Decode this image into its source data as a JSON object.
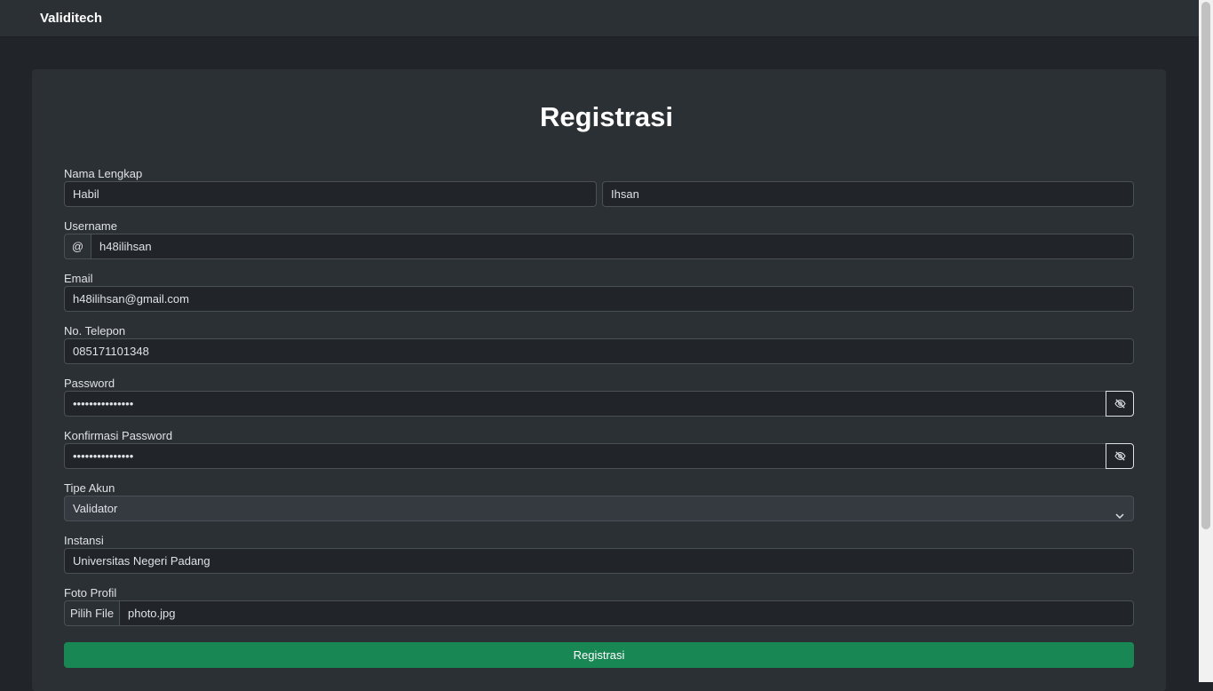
{
  "navbar": {
    "brand": "Validitech"
  },
  "form": {
    "title": "Registrasi",
    "full_name": {
      "label": "Nama Lengkap",
      "first": "Habil",
      "last": "Ihsan"
    },
    "username": {
      "label": "Username",
      "prefix": "@",
      "value": "h48ilihsan"
    },
    "email": {
      "label": "Email",
      "value": "h48ilihsan@gmail.com"
    },
    "phone": {
      "label": "No. Telepon",
      "value": "085171101348"
    },
    "password": {
      "label": "Password",
      "masked": "•••••••••••••••"
    },
    "confirm_password": {
      "label": "Konfirmasi Password",
      "masked": "•••••••••••••••"
    },
    "account_type": {
      "label": "Tipe Akun",
      "selected": "Validator"
    },
    "institution": {
      "label": "Instansi",
      "value": "Universitas Negeri Padang"
    },
    "photo": {
      "label": "Foto Profil",
      "button": "Pilih File",
      "filename": "photo.jpg"
    },
    "submit_label": "Registrasi"
  },
  "icons": {
    "password_toggle": "eye-slash-icon",
    "select": "chevron-down-icon"
  },
  "colors": {
    "background": "#212529",
    "card": "#2b3035",
    "accent_success": "#198754"
  }
}
